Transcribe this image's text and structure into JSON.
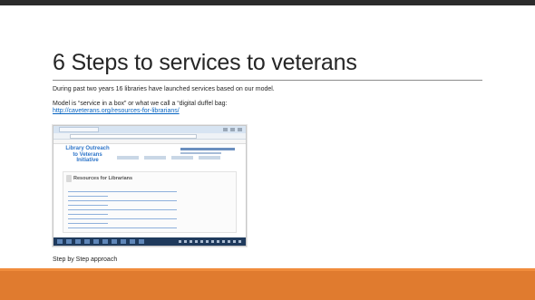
{
  "slide": {
    "title": "6 Steps to services to veterans",
    "body_line_1": "During past two years 16 libraries have launched services based on our model.",
    "body_line_2": "Model is “service in a box” or what we call a “digital duffel bag:",
    "link_text": "http://caveterans.org/resources-for-librarians/",
    "caption": "Step by Step approach"
  },
  "embedded_screenshot": {
    "logo_text": "Library Outreach to Veterans Initiative",
    "page_heading": "Resources for Librarians"
  },
  "colors": {
    "footer_orange": "#e07b2f",
    "top_bar": "#2b2b2b",
    "link_blue": "#0563c1"
  }
}
